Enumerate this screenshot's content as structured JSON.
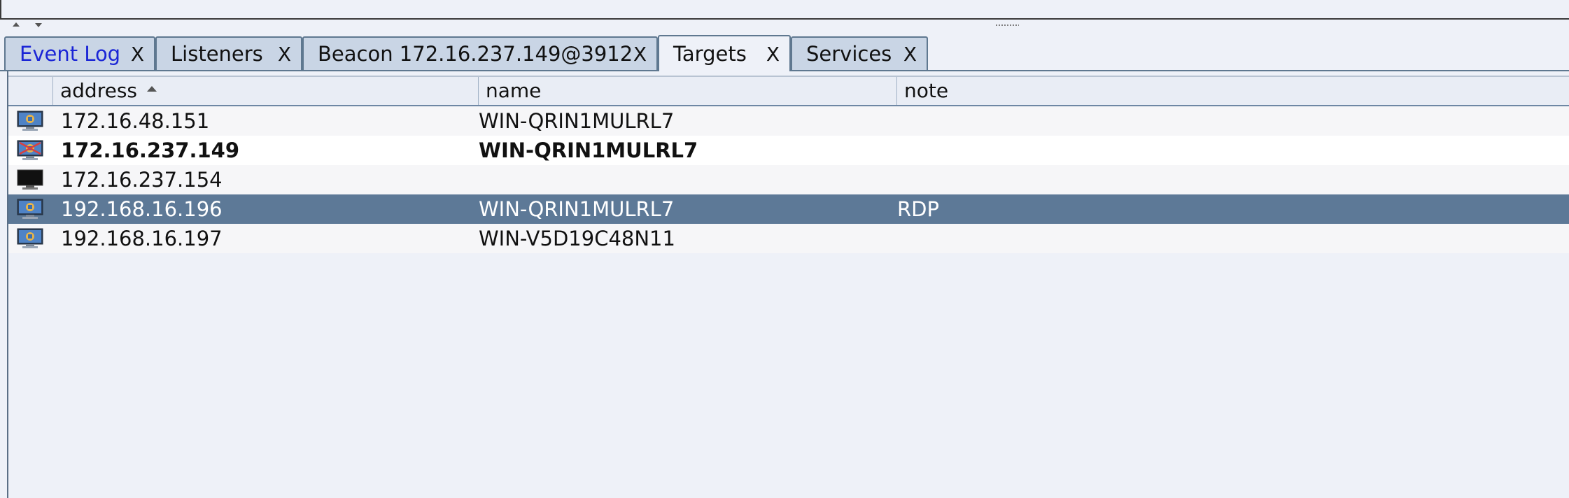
{
  "tabs": [
    {
      "label": "Event Log",
      "close": "X"
    },
    {
      "label": "Listeners",
      "close": "X"
    },
    {
      "label": "Beacon 172.16.237.149@3912",
      "close": "X"
    },
    {
      "label": "Targets",
      "close": "X"
    },
    {
      "label": "Services",
      "close": "X"
    }
  ],
  "active_tab": "Targets",
  "table": {
    "columns": {
      "address": "address",
      "name": "name",
      "note": "note"
    },
    "sort": {
      "column": "address",
      "direction": "ascending"
    },
    "rows": [
      {
        "icon": "windows-monitor-icon",
        "address": "172.16.48.151",
        "name": "WIN-QRIN1MULRL7",
        "note": ""
      },
      {
        "icon": "windows-monitor-compromised-icon",
        "address": "172.16.237.149",
        "name": "WIN-QRIN1MULRL7",
        "note": "",
        "bold": true
      },
      {
        "icon": "unknown-monitor-icon",
        "address": "172.16.237.154",
        "name": "",
        "note": ""
      },
      {
        "icon": "windows-monitor-icon",
        "address": "192.168.16.196",
        "name": "WIN-QRIN1MULRL7",
        "note": "RDP",
        "selected": true
      },
      {
        "icon": "windows-monitor-icon",
        "address": "192.168.16.197",
        "name": "WIN-V5D19C48N11",
        "note": ""
      }
    ]
  },
  "colors": {
    "selection": "#5d7997",
    "tab_border": "#5f7890",
    "event_log_text": "#1a25d6"
  }
}
